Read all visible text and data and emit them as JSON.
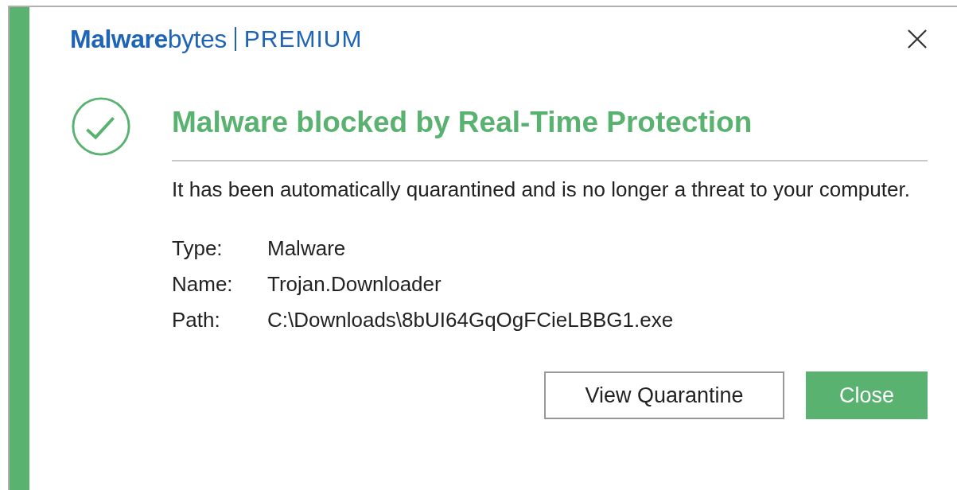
{
  "brand": {
    "name": "**Malware**bytes",
    "edition": "PREMIUM"
  },
  "title": "Malware blocked by Real-Time Protection",
  "message": "It has been automatically quarantined and is no longer a threat to your computer.",
  "details": [
    {
      "label": "Type:",
      "value": "Malware"
    },
    {
      "label": "Name:",
      "value": "Trojan.Downloader"
    },
    {
      "label": "Path:",
      "value": "C:\\Downloads\\8bUI64GqOgFCieLBBG1.exe"
    }
  ],
  "buttons": [
    {
      "label": "View Quarantine",
      "kind": "secondary"
    },
    {
      "label": "Close",
      "kind": "primary"
    }
  ]
}
